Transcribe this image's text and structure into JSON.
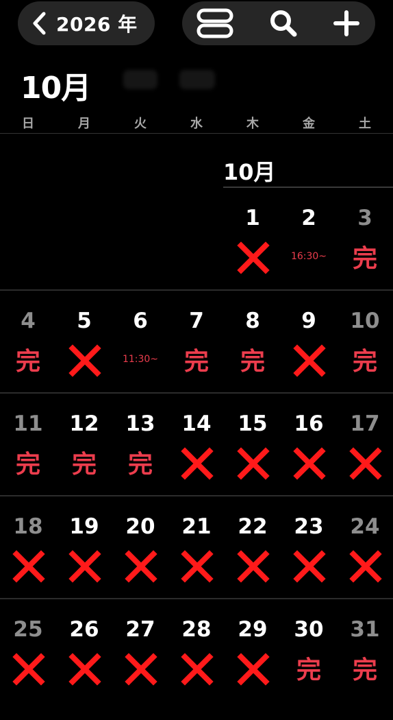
{
  "header": {
    "back_label": "2026 年",
    "month_title": "10月"
  },
  "toolbar": {
    "buttons": [
      "layout-toggle-icon",
      "search-icon",
      "plus-icon"
    ]
  },
  "weekdays": [
    "日",
    "月",
    "火",
    "水",
    "木",
    "金",
    "土"
  ],
  "calendar": {
    "inline_month_label": "10月",
    "status_legend": {
      "x": "unavailable",
      "done": "完"
    },
    "colors": {
      "background": "#000000",
      "pill": "#262626",
      "accent_red": "#ec3d4d",
      "x_red": "#ff1a1a",
      "weekend_gray": "#8e8e8e"
    },
    "days": [
      {
        "day": "1",
        "mark": "x"
      },
      {
        "day": "2",
        "mark": "time",
        "text": "16:30~"
      },
      {
        "day": "3",
        "mark": "done",
        "text": "完"
      },
      {
        "day": "4",
        "mark": "done",
        "text": "完"
      },
      {
        "day": "5",
        "mark": "x"
      },
      {
        "day": "6",
        "mark": "time",
        "text": "11:30~"
      },
      {
        "day": "7",
        "mark": "done",
        "text": "完"
      },
      {
        "day": "8",
        "mark": "done",
        "text": "完"
      },
      {
        "day": "9",
        "mark": "x"
      },
      {
        "day": "10",
        "mark": "done",
        "text": "完"
      },
      {
        "day": "11",
        "mark": "done",
        "text": "完"
      },
      {
        "day": "12",
        "mark": "done",
        "text": "完"
      },
      {
        "day": "13",
        "mark": "done",
        "text": "完"
      },
      {
        "day": "14",
        "mark": "x"
      },
      {
        "day": "15",
        "mark": "x"
      },
      {
        "day": "16",
        "mark": "x"
      },
      {
        "day": "17",
        "mark": "x"
      },
      {
        "day": "18",
        "mark": "x"
      },
      {
        "day": "19",
        "mark": "x"
      },
      {
        "day": "20",
        "mark": "x"
      },
      {
        "day": "21",
        "mark": "x"
      },
      {
        "day": "22",
        "mark": "x"
      },
      {
        "day": "23",
        "mark": "x"
      },
      {
        "day": "24",
        "mark": "x"
      },
      {
        "day": "25",
        "mark": "x"
      },
      {
        "day": "26",
        "mark": "x"
      },
      {
        "day": "27",
        "mark": "x"
      },
      {
        "day": "28",
        "mark": "x"
      },
      {
        "day": "29",
        "mark": "x"
      },
      {
        "day": "30",
        "mark": "done",
        "text": "完"
      },
      {
        "day": "31",
        "mark": "done",
        "text": "完"
      }
    ]
  }
}
